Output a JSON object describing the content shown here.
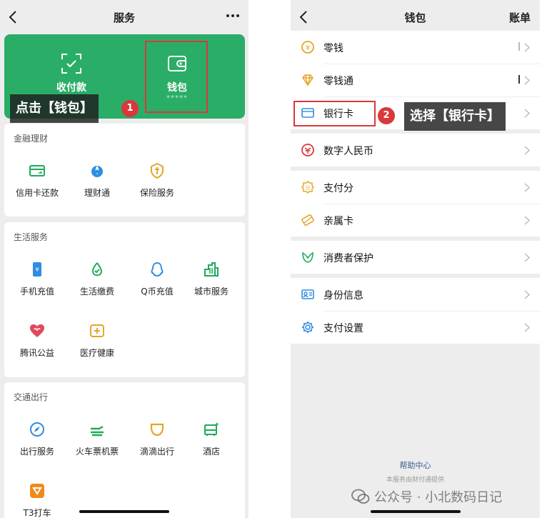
{
  "left": {
    "title": "服务",
    "card": {
      "pay_label": "收付款",
      "wallet_label": "钱包",
      "wallet_sub": "*****"
    },
    "callout": "点击【钱包】",
    "step": "1",
    "sections": [
      {
        "title": "金融理财",
        "items": [
          {
            "label": "信用卡还款",
            "icon": "credit-card-icon"
          },
          {
            "label": "理财通",
            "icon": "wealth-icon"
          },
          {
            "label": "保险服务",
            "icon": "insurance-icon"
          }
        ]
      },
      {
        "title": "生活服务",
        "items": [
          {
            "label": "手机充值",
            "icon": "phone-topup-icon"
          },
          {
            "label": "生活缴费",
            "icon": "utility-icon"
          },
          {
            "label": "Q币充值",
            "icon": "qq-icon"
          },
          {
            "label": "城市服务",
            "icon": "city-icon"
          },
          {
            "label": "腾讯公益",
            "icon": "charity-icon"
          },
          {
            "label": "医疗健康",
            "icon": "medical-icon"
          }
        ]
      },
      {
        "title": "交通出行",
        "items": [
          {
            "label": "出行服务",
            "icon": "travel-icon"
          },
          {
            "label": "火车票机票",
            "icon": "train-icon"
          },
          {
            "label": "滴滴出行",
            "icon": "didi-icon"
          },
          {
            "label": "酒店",
            "icon": "hotel-icon"
          },
          {
            "label": "T3打车",
            "icon": "t3-icon"
          }
        ]
      }
    ]
  },
  "right": {
    "title": "钱包",
    "right_action": "账单",
    "groups": [
      [
        {
          "label": "零钱",
          "icon": "yuan-coin-icon"
        },
        {
          "label": "零钱通",
          "icon": "diamond-icon"
        },
        {
          "label": "银行卡",
          "icon": "bank-card-icon"
        }
      ],
      [
        {
          "label": "数字人民币",
          "icon": "digital-rmb-icon"
        }
      ],
      [
        {
          "label": "支付分",
          "icon": "pay-score-icon"
        },
        {
          "label": "亲属卡",
          "icon": "family-card-icon"
        }
      ],
      [
        {
          "label": "消费者保护",
          "icon": "protection-icon"
        }
      ],
      [
        {
          "label": "身份信息",
          "icon": "id-card-icon"
        },
        {
          "label": "支付设置",
          "icon": "settings-gear-icon"
        }
      ]
    ],
    "callout": "选择【银行卡】",
    "step": "2",
    "footer_link": "帮助中心",
    "footer_note": "本服务由财付通提供"
  },
  "watermark": "公众号 · 小北数码日记",
  "colors": {
    "brand_green": "#2aae67",
    "annotation_red": "#d9393a",
    "icon_gold": "#e5a52a",
    "icon_green": "#20a95b"
  }
}
